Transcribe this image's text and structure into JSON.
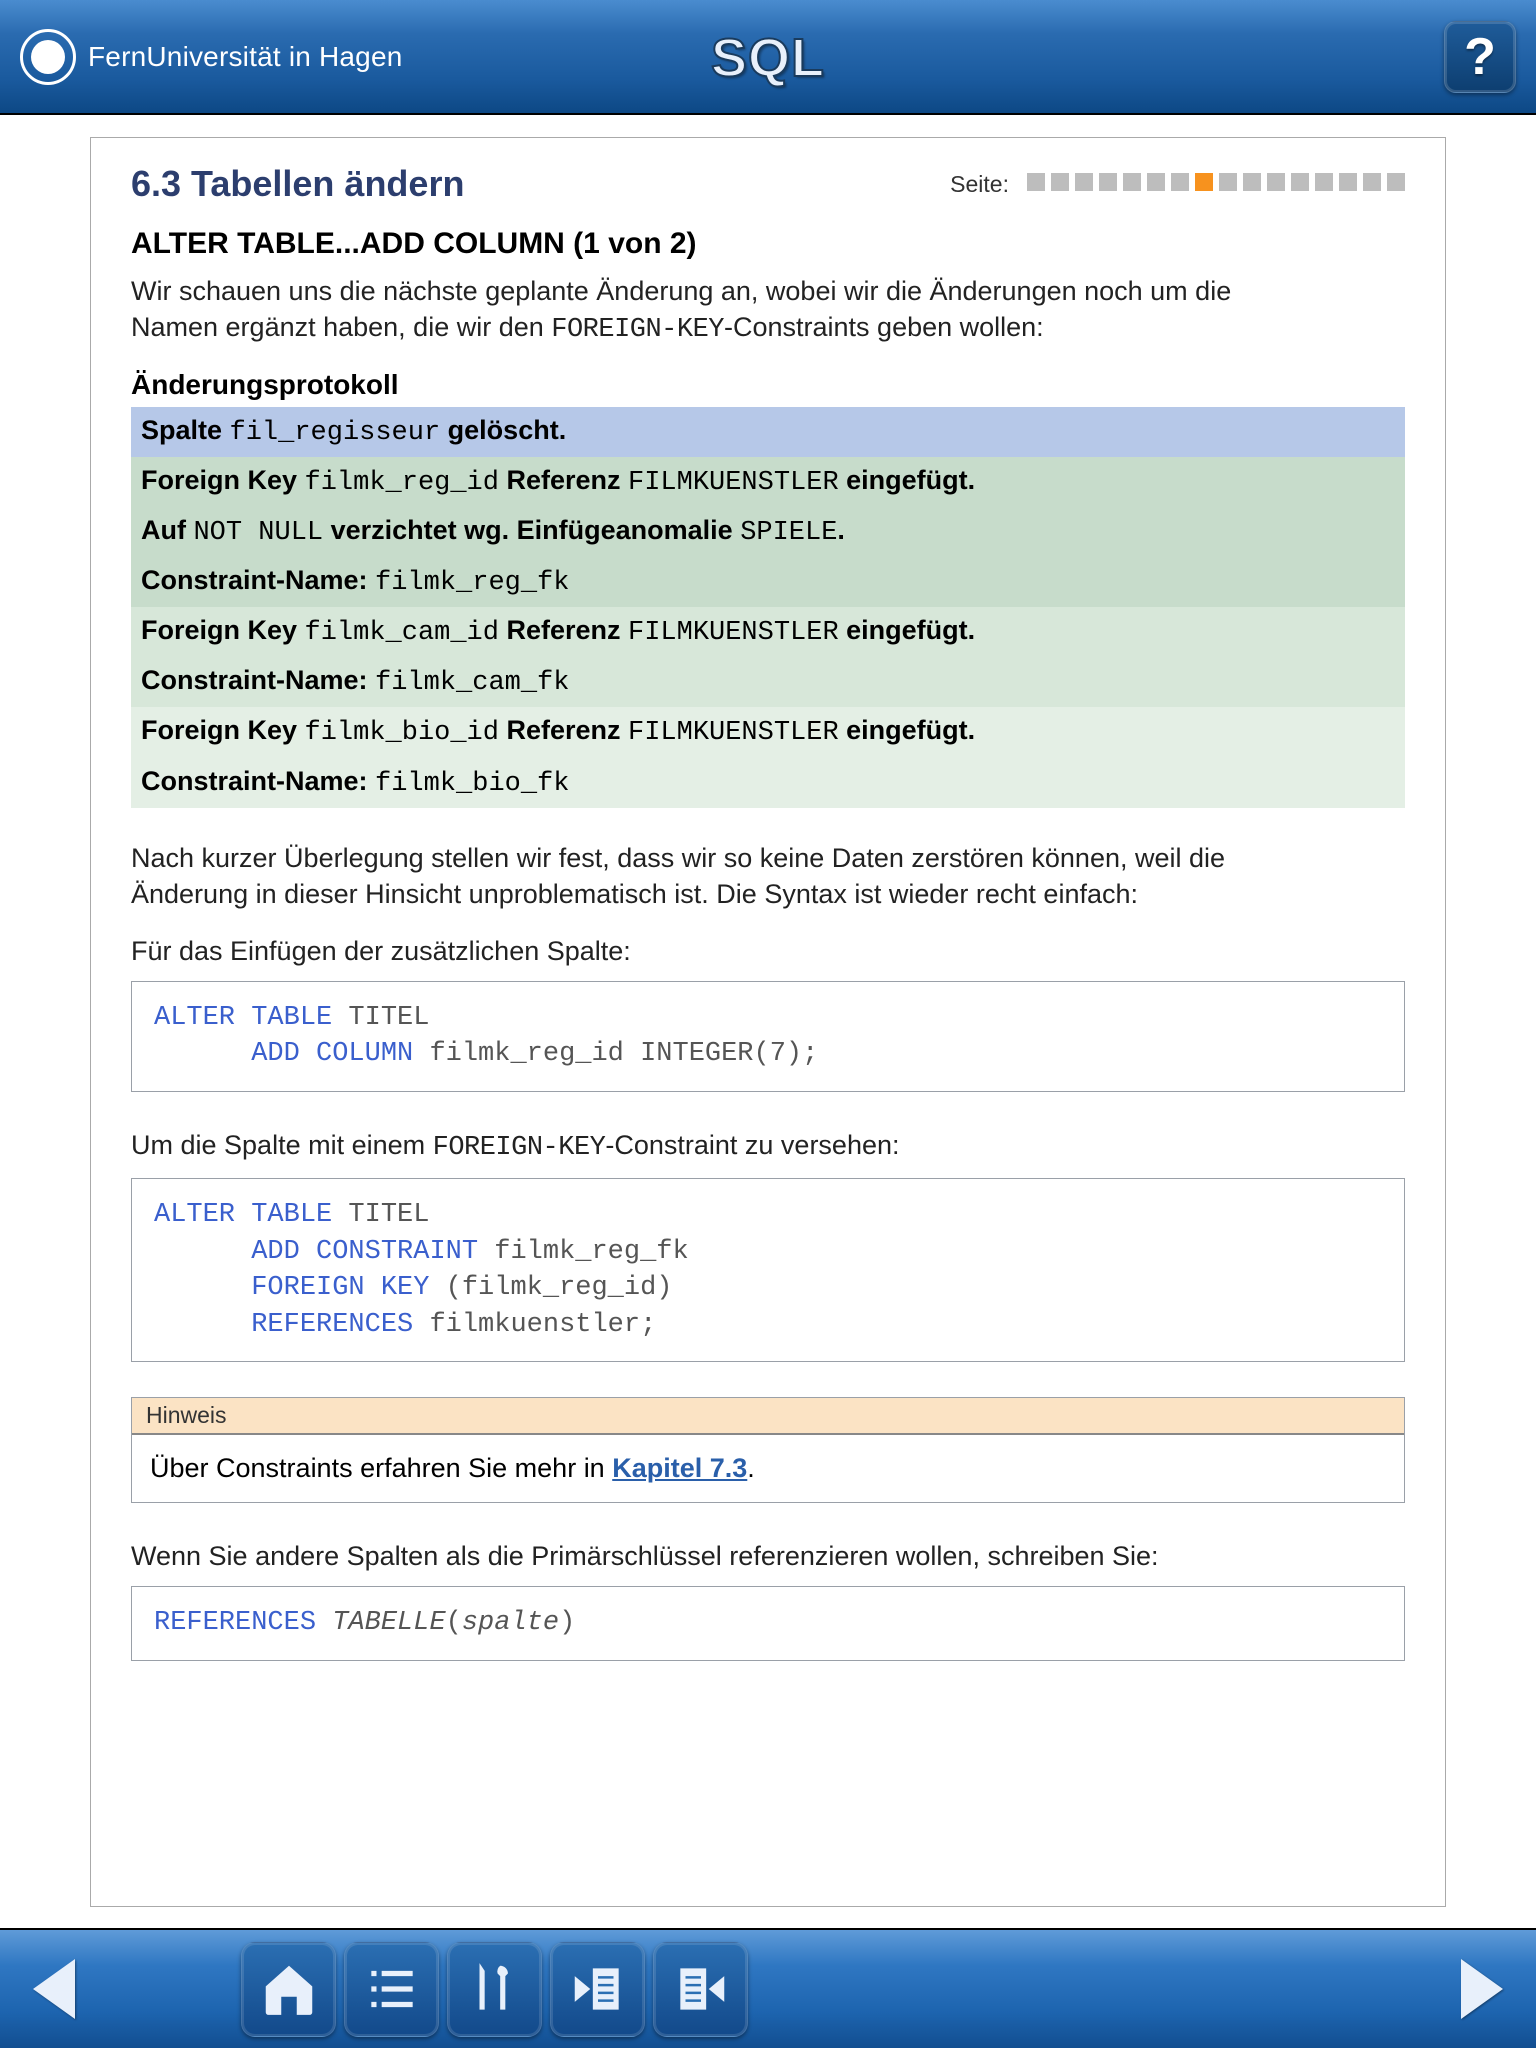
{
  "brand": "FernUniversität in Hagen",
  "app_title": "SQL",
  "pager": {
    "label": "Seite:",
    "total": 16,
    "current_index": 7
  },
  "section": {
    "number_title": "6.3 Tabellen ändern",
    "title": "ALTER TABLE...ADD COLUMN (1 von 2)",
    "intro_pre": "Wir schauen uns die nächste geplante Änderung an, wobei wir die Änderungen noch um die Namen ergänzt haben, die wir den ",
    "intro_code": "FOREIGN-KEY",
    "intro_post": "-Constraints geben wollen:"
  },
  "changes": {
    "heading": "Änderungsprotokoll",
    "rows": [
      {
        "style": "row-blue",
        "parts": [
          "Spalte ",
          "fil_regisseur",
          " gelöscht."
        ]
      },
      {
        "style": "row-green1",
        "parts": [
          "Foreign Key ",
          "filmk_reg_id",
          " Referenz ",
          "FILMKUENSTLER",
          " eingefügt."
        ]
      },
      {
        "style": "row-green1",
        "parts": [
          "Auf ",
          "NOT NULL",
          " verzichtet wg. Einfügeanomalie ",
          "SPIELE",
          "."
        ]
      },
      {
        "style": "row-green1",
        "parts": [
          "Constraint-Name: ",
          "filmk_reg_fk"
        ]
      },
      {
        "style": "row-green2",
        "parts": [
          "Foreign Key ",
          "filmk_cam_id",
          " Referenz ",
          "FILMKUENSTLER",
          " eingefügt."
        ]
      },
      {
        "style": "row-green2",
        "parts": [
          "Constraint-Name: ",
          "filmk_cam_fk"
        ]
      },
      {
        "style": "row-green3",
        "parts": [
          "Foreign Key ",
          "filmk_bio_id",
          " Referenz ",
          "FILMKUENSTLER",
          " eingefügt."
        ]
      },
      {
        "style": "row-green3",
        "parts": [
          "Constraint-Name: ",
          "filmk_bio_fk"
        ]
      }
    ]
  },
  "mid_para": "Nach kurzer Überlegung stellen wir fest, dass wir so keine Daten zerstören können, weil die Änderung in dieser Hinsicht unproblematisch ist. Die Syntax ist wieder recht einfach:",
  "lead1": "Für das Einfügen der zusätzlichen Spalte:",
  "code1": [
    {
      "kw": "ALTER TABLE",
      "rest": " TITEL"
    },
    {
      "indent": "      ",
      "kw": "ADD COLUMN",
      "rest": " filmk_reg_id INTEGER(7);"
    }
  ],
  "lead2_pre": "Um die Spalte mit einem ",
  "lead2_code": "FOREIGN-KEY",
  "lead2_post": "-Constraint zu versehen:",
  "code2": [
    {
      "kw": "ALTER TABLE",
      "rest": " TITEL"
    },
    {
      "indent": "      ",
      "kw": "ADD CONSTRAINT",
      "rest": " filmk_reg_fk"
    },
    {
      "indent": "      ",
      "kw": "FOREIGN KEY",
      "rest": " (filmk_reg_id)"
    },
    {
      "indent": "      ",
      "kw": "REFERENCES",
      "rest": " filmkuenstler;"
    }
  ],
  "hint": {
    "label": "Hinweis",
    "text_pre": "Über Constraints erfahren Sie mehr in ",
    "link": "Kapitel 7.3",
    "text_post": "."
  },
  "tail_para": "Wenn Sie andere Spalten als die Primärschlüssel referenzieren wollen, schreiben Sie:",
  "code3": [
    {
      "kw": "REFERENCES",
      "ital_rest": " TABELLE",
      "plain": "(",
      "ital2": "spalte",
      "plain2": ")"
    }
  ]
}
